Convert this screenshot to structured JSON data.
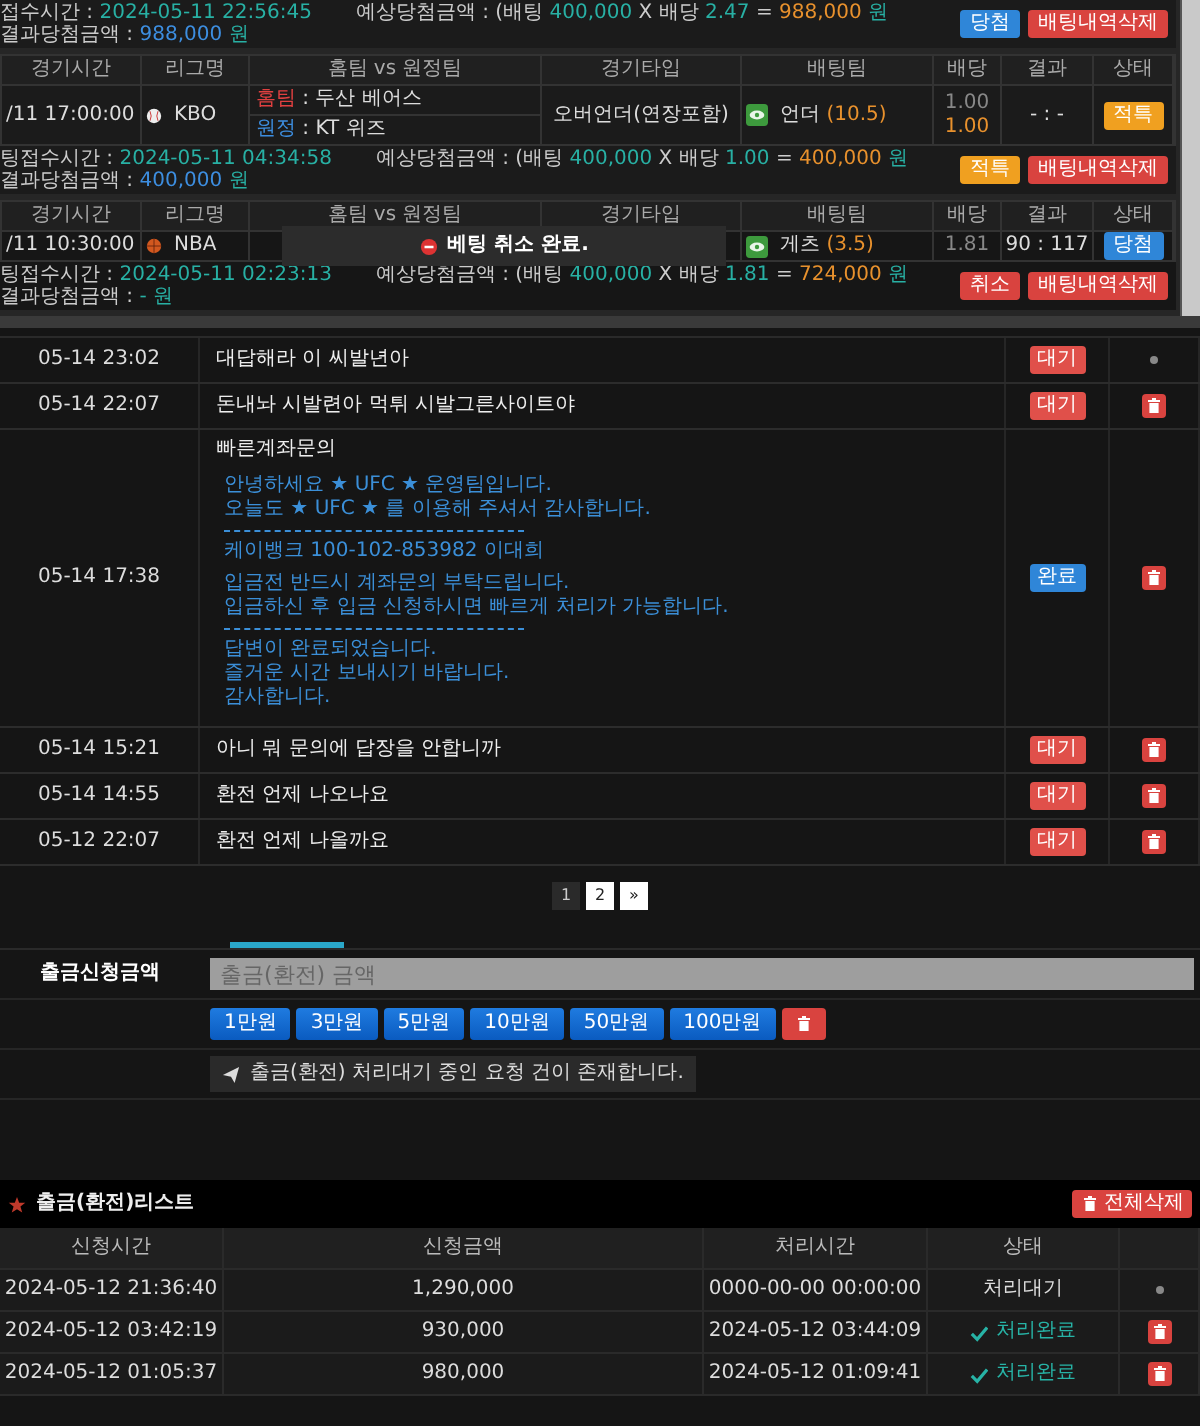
{
  "bet_history": {
    "slips": [
      {
        "footer": {
          "fields": [
            {
              "segments": [
                {
                  "text": "접수시간 : ",
                  "color": "#cccccc"
                },
                {
                  "text": "2024-05-11 22:56:45",
                  "color": "#28b0a4"
                }
              ]
            },
            {
              "segments": [
                {
                  "text": "예상당첨금액 : (배팅 ",
                  "color": "#cccccc"
                },
                {
                  "text": "400,000",
                  "color": "#28b0a4"
                },
                {
                  "text": " X 배당 ",
                  "color": "#cccccc"
                },
                {
                  "text": "2.47",
                  "color": "#28b0a4"
                },
                {
                  "text": " = ",
                  "color": "#cccccc"
                },
                {
                  "text": "988,000",
                  "color": "#e8912d"
                },
                {
                  "text": " 원",
                  "color": "#28b0a4"
                }
              ]
            },
            {
              "segments": [
                {
                  "text": "결과당첨금액 : ",
                  "color": "#cccccc"
                },
                {
                  "text": "988,000",
                  "color": "#3d8ee0"
                },
                {
                  "text": " 원",
                  "color": "#28b0a4"
                }
              ]
            }
          ],
          "buttons": [
            {
              "label": "당첨",
              "kind": "win"
            },
            {
              "label": "배팅내역삭제",
              "kind": "delete"
            }
          ]
        }
      },
      {
        "columns": [
          "경기시간",
          "리그명",
          "홈팀 vs 원정팀",
          "경기타입",
          "배팅팀",
          "배당",
          "결과",
          "상태"
        ],
        "games": [
          {
            "time": "/11 17:00:00",
            "kind": "baseball",
            "league": "KBO",
            "teams": [
              {
                "kind": "home",
                "label": "홈팀",
                "name": " : 두산 베어스"
              },
              {
                "kind": "away",
                "label": "원정",
                "name": " : KT 위즈"
              }
            ],
            "type": "오버언더(연장포함)",
            "pick": "언더",
            "pick_line": "(10.5)",
            "odds": [
              {
                "value": "1.00",
                "kind": "base"
              },
              {
                "value": "1.00",
                "kind": "applied"
              }
            ],
            "result": "- : -",
            "status": {
              "label": "적특",
              "kind": "void"
            }
          }
        ],
        "footer": {
          "fields": [
            {
              "segments": [
                {
                  "text": "팅접수시간 : ",
                  "color": "#cccccc"
                },
                {
                  "text": "2024-05-11 04:34:58",
                  "color": "#28b0a4"
                }
              ]
            },
            {
              "segments": [
                {
                  "text": "예상당첨금액 : (배팅 ",
                  "color": "#cccccc"
                },
                {
                  "text": "400,000",
                  "color": "#28b0a4"
                },
                {
                  "text": " X 배당 ",
                  "color": "#cccccc"
                },
                {
                  "text": "1.00",
                  "color": "#28b0a4"
                },
                {
                  "text": " = ",
                  "color": "#cccccc"
                },
                {
                  "text": "400,000",
                  "color": "#e8912d"
                },
                {
                  "text": " 원",
                  "color": "#28b0a4"
                }
              ]
            },
            {
              "segments": [
                {
                  "text": "결과당첨금액 : ",
                  "color": "#cccccc"
                },
                {
                  "text": "400,000",
                  "color": "#3d8ee0"
                },
                {
                  "text": " 원",
                  "color": "#28b0a4"
                }
              ]
            }
          ],
          "buttons": [
            {
              "label": "적특",
              "kind": "void"
            },
            {
              "label": "배팅내역삭제",
              "kind": "delete"
            }
          ]
        }
      },
      {
        "columns": [
          "경기시간",
          "리그명",
          "홈팀 vs 원정팀",
          "경기타입",
          "배팅팀",
          "배당",
          "결과",
          "상태"
        ],
        "games": [
          {
            "time": "/11 10:30:00",
            "kind": "basketball",
            "league": "NBA",
            "pick": "게츠",
            "pick_line": "(3.5)",
            "odds": [
              {
                "value": "1.81",
                "kind": "base"
              }
            ],
            "result": "90 : 117",
            "status": {
              "label": "당첨",
              "kind": "win"
            },
            "toast": "베팅 취소 완료."
          }
        ],
        "footer": {
          "fields": [
            {
              "segments": [
                {
                  "text": "팅접수시간 : ",
                  "color": "#cccccc"
                },
                {
                  "text": "2024-05-11 02:23:13",
                  "color": "#28b0a4"
                }
              ]
            },
            {
              "segments": [
                {
                  "text": "예상당첨금액 : (배팅 ",
                  "color": "#cccccc"
                },
                {
                  "text": "400,000",
                  "color": "#28b0a4"
                },
                {
                  "text": " X 배당 ",
                  "color": "#cccccc"
                },
                {
                  "text": "1.81",
                  "color": "#28b0a4"
                },
                {
                  "text": " = ",
                  "color": "#cccccc"
                },
                {
                  "text": "724,000",
                  "color": "#e8912d"
                },
                {
                  "text": " 원",
                  "color": "#28b0a4"
                }
              ]
            },
            {
              "segments": [
                {
                  "text": "결과당첨금액 : ",
                  "color": "#cccccc"
                },
                {
                  "text": "- 원",
                  "color": "#28b0a4"
                }
              ]
            }
          ],
          "buttons": [
            {
              "label": "취소",
              "kind": "delete"
            },
            {
              "label": "배팅내역삭제",
              "kind": "delete"
            }
          ]
        }
      }
    ]
  },
  "inquiries": [
    {
      "date": "05-14 23:02",
      "title": "대답해라 이 씨발년아",
      "status": {
        "label": "대기",
        "kind": "pending"
      },
      "deletable": false
    },
    {
      "date": "05-14 22:07",
      "title": "돈내놔 시발련아 먹튀 시발그른사이트야",
      "status": {
        "label": "대기",
        "kind": "pending"
      },
      "deletable": true
    },
    {
      "date": "05-14 17:38",
      "title": "빠른계좌문의",
      "answer": [
        {
          "kind": "text",
          "lines": [
            "안녕하세요 ★ UFC ★ 운영팀입니다.",
            "오늘도 ★ UFC ★ 를 이용해 주셔서 감사합니다."
          ]
        },
        {
          "kind": "divider"
        },
        {
          "kind": "text",
          "lines": [
            "케이뱅크 100-102-853982 이대희"
          ]
        },
        {
          "kind": "text",
          "lines": [
            "입금전 반드시 계좌문의 부탁드립니다.",
            "입금하신 후 입금 신청하시면 빠르게 처리가 가능합니다."
          ]
        },
        {
          "kind": "divider"
        },
        {
          "kind": "text",
          "lines": [
            "답변이 완료되었습니다.",
            "즐거운 시간 보내시기 바랍니다.",
            "감사합니다."
          ]
        }
      ],
      "status": {
        "label": "완료",
        "kind": "done"
      },
      "deletable": true
    },
    {
      "date": "05-14 15:21",
      "title": "아니 뭐 문의에 답장을 안합니까",
      "status": {
        "label": "대기",
        "kind": "pending"
      },
      "deletable": true
    },
    {
      "date": "05-14 14:55",
      "title": "환전 언제 나오나요",
      "status": {
        "label": "대기",
        "kind": "pending"
      },
      "deletable": true
    },
    {
      "date": "05-12 22:07",
      "title": "환전 언제 나올까요",
      "status": {
        "label": "대기",
        "kind": "pending"
      },
      "deletable": true
    }
  ],
  "pagination": {
    "pages": [
      {
        "label": "1",
        "selected": true
      },
      {
        "label": "2",
        "selected": false
      }
    ],
    "next": "»"
  },
  "withdraw_form": {
    "label": "출금신청금액",
    "placeholder": "출금(환전) 금액",
    "amounts": [
      "1만원",
      "3만원",
      "5만원",
      "10만원",
      "50만원",
      "100만원"
    ],
    "notice": "출금(환전) 처리대기 중인 요청 건이 존재합니다."
  },
  "withdraw_list": {
    "title": "출금(환전)리스트",
    "delete_all": "전체삭제",
    "columns": [
      "신청시간",
      "신청금액",
      "처리시간",
      "상태"
    ],
    "rows": [
      {
        "requested": "2024-05-12 21:36:40",
        "amount": "1,290,000",
        "processed": "0000-00-00 00:00:00",
        "status": {
          "label": "처리대기",
          "kind": "pending"
        },
        "deletable": false
      },
      {
        "requested": "2024-05-12 03:42:19",
        "amount": "930,000",
        "processed": "2024-05-12 03:44:09",
        "status": {
          "label": "처리완료",
          "kind": "done"
        },
        "deletable": true
      },
      {
        "requested": "2024-05-12 01:05:37",
        "amount": "980,000",
        "processed": "2024-05-12 01:09:41",
        "status": {
          "label": "처리완료",
          "kind": "done"
        },
        "deletable": true
      }
    ]
  }
}
